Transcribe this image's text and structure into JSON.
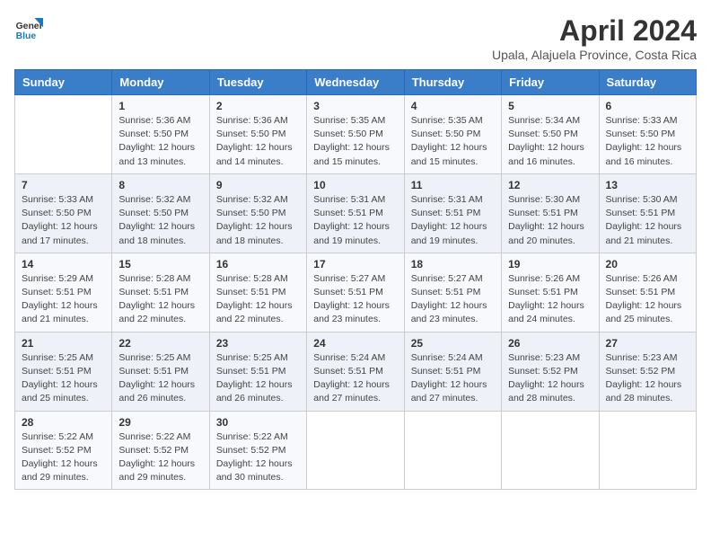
{
  "logo": {
    "text_general": "General",
    "text_blue": "Blue"
  },
  "header": {
    "month_year": "April 2024",
    "location": "Upala, Alajuela Province, Costa Rica"
  },
  "weekdays": [
    "Sunday",
    "Monday",
    "Tuesday",
    "Wednesday",
    "Thursday",
    "Friday",
    "Saturday"
  ],
  "weeks": [
    [
      {
        "day": "",
        "sunrise": "",
        "sunset": "",
        "daylight": ""
      },
      {
        "day": "1",
        "sunrise": "Sunrise: 5:36 AM",
        "sunset": "Sunset: 5:50 PM",
        "daylight": "Daylight: 12 hours and 13 minutes."
      },
      {
        "day": "2",
        "sunrise": "Sunrise: 5:36 AM",
        "sunset": "Sunset: 5:50 PM",
        "daylight": "Daylight: 12 hours and 14 minutes."
      },
      {
        "day": "3",
        "sunrise": "Sunrise: 5:35 AM",
        "sunset": "Sunset: 5:50 PM",
        "daylight": "Daylight: 12 hours and 15 minutes."
      },
      {
        "day": "4",
        "sunrise": "Sunrise: 5:35 AM",
        "sunset": "Sunset: 5:50 PM",
        "daylight": "Daylight: 12 hours and 15 minutes."
      },
      {
        "day": "5",
        "sunrise": "Sunrise: 5:34 AM",
        "sunset": "Sunset: 5:50 PM",
        "daylight": "Daylight: 12 hours and 16 minutes."
      },
      {
        "day": "6",
        "sunrise": "Sunrise: 5:33 AM",
        "sunset": "Sunset: 5:50 PM",
        "daylight": "Daylight: 12 hours and 16 minutes."
      }
    ],
    [
      {
        "day": "7",
        "sunrise": "Sunrise: 5:33 AM",
        "sunset": "Sunset: 5:50 PM",
        "daylight": "Daylight: 12 hours and 17 minutes."
      },
      {
        "day": "8",
        "sunrise": "Sunrise: 5:32 AM",
        "sunset": "Sunset: 5:50 PM",
        "daylight": "Daylight: 12 hours and 18 minutes."
      },
      {
        "day": "9",
        "sunrise": "Sunrise: 5:32 AM",
        "sunset": "Sunset: 5:50 PM",
        "daylight": "Daylight: 12 hours and 18 minutes."
      },
      {
        "day": "10",
        "sunrise": "Sunrise: 5:31 AM",
        "sunset": "Sunset: 5:51 PM",
        "daylight": "Daylight: 12 hours and 19 minutes."
      },
      {
        "day": "11",
        "sunrise": "Sunrise: 5:31 AM",
        "sunset": "Sunset: 5:51 PM",
        "daylight": "Daylight: 12 hours and 19 minutes."
      },
      {
        "day": "12",
        "sunrise": "Sunrise: 5:30 AM",
        "sunset": "Sunset: 5:51 PM",
        "daylight": "Daylight: 12 hours and 20 minutes."
      },
      {
        "day": "13",
        "sunrise": "Sunrise: 5:30 AM",
        "sunset": "Sunset: 5:51 PM",
        "daylight": "Daylight: 12 hours and 21 minutes."
      }
    ],
    [
      {
        "day": "14",
        "sunrise": "Sunrise: 5:29 AM",
        "sunset": "Sunset: 5:51 PM",
        "daylight": "Daylight: 12 hours and 21 minutes."
      },
      {
        "day": "15",
        "sunrise": "Sunrise: 5:28 AM",
        "sunset": "Sunset: 5:51 PM",
        "daylight": "Daylight: 12 hours and 22 minutes."
      },
      {
        "day": "16",
        "sunrise": "Sunrise: 5:28 AM",
        "sunset": "Sunset: 5:51 PM",
        "daylight": "Daylight: 12 hours and 22 minutes."
      },
      {
        "day": "17",
        "sunrise": "Sunrise: 5:27 AM",
        "sunset": "Sunset: 5:51 PM",
        "daylight": "Daylight: 12 hours and 23 minutes."
      },
      {
        "day": "18",
        "sunrise": "Sunrise: 5:27 AM",
        "sunset": "Sunset: 5:51 PM",
        "daylight": "Daylight: 12 hours and 23 minutes."
      },
      {
        "day": "19",
        "sunrise": "Sunrise: 5:26 AM",
        "sunset": "Sunset: 5:51 PM",
        "daylight": "Daylight: 12 hours and 24 minutes."
      },
      {
        "day": "20",
        "sunrise": "Sunrise: 5:26 AM",
        "sunset": "Sunset: 5:51 PM",
        "daylight": "Daylight: 12 hours and 25 minutes."
      }
    ],
    [
      {
        "day": "21",
        "sunrise": "Sunrise: 5:25 AM",
        "sunset": "Sunset: 5:51 PM",
        "daylight": "Daylight: 12 hours and 25 minutes."
      },
      {
        "day": "22",
        "sunrise": "Sunrise: 5:25 AM",
        "sunset": "Sunset: 5:51 PM",
        "daylight": "Daylight: 12 hours and 26 minutes."
      },
      {
        "day": "23",
        "sunrise": "Sunrise: 5:25 AM",
        "sunset": "Sunset: 5:51 PM",
        "daylight": "Daylight: 12 hours and 26 minutes."
      },
      {
        "day": "24",
        "sunrise": "Sunrise: 5:24 AM",
        "sunset": "Sunset: 5:51 PM",
        "daylight": "Daylight: 12 hours and 27 minutes."
      },
      {
        "day": "25",
        "sunrise": "Sunrise: 5:24 AM",
        "sunset": "Sunset: 5:51 PM",
        "daylight": "Daylight: 12 hours and 27 minutes."
      },
      {
        "day": "26",
        "sunrise": "Sunrise: 5:23 AM",
        "sunset": "Sunset: 5:52 PM",
        "daylight": "Daylight: 12 hours and 28 minutes."
      },
      {
        "day": "27",
        "sunrise": "Sunrise: 5:23 AM",
        "sunset": "Sunset: 5:52 PM",
        "daylight": "Daylight: 12 hours and 28 minutes."
      }
    ],
    [
      {
        "day": "28",
        "sunrise": "Sunrise: 5:22 AM",
        "sunset": "Sunset: 5:52 PM",
        "daylight": "Daylight: 12 hours and 29 minutes."
      },
      {
        "day": "29",
        "sunrise": "Sunrise: 5:22 AM",
        "sunset": "Sunset: 5:52 PM",
        "daylight": "Daylight: 12 hours and 29 minutes."
      },
      {
        "day": "30",
        "sunrise": "Sunrise: 5:22 AM",
        "sunset": "Sunset: 5:52 PM",
        "daylight": "Daylight: 12 hours and 30 minutes."
      },
      {
        "day": "",
        "sunrise": "",
        "sunset": "",
        "daylight": ""
      },
      {
        "day": "",
        "sunrise": "",
        "sunset": "",
        "daylight": ""
      },
      {
        "day": "",
        "sunrise": "",
        "sunset": "",
        "daylight": ""
      },
      {
        "day": "",
        "sunrise": "",
        "sunset": "",
        "daylight": ""
      }
    ]
  ]
}
